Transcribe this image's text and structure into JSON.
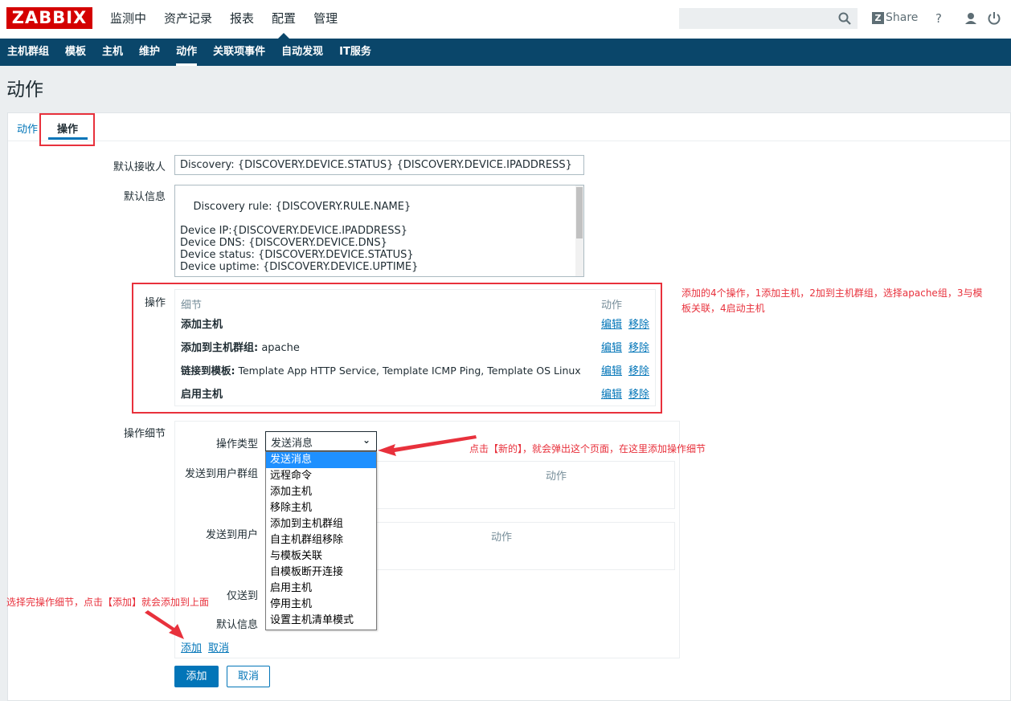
{
  "header": {
    "logo": "ZABBIX",
    "menu": [
      {
        "label": "监测中",
        "active": false
      },
      {
        "label": "资产记录",
        "active": false
      },
      {
        "label": "报表",
        "active": false
      },
      {
        "label": "配置",
        "active": true
      },
      {
        "label": "管理",
        "active": false
      }
    ],
    "search_value": "",
    "share_badge": "Z",
    "share_label": "Share",
    "help_glyph": "?",
    "icons": [
      "search-icon",
      "share-icon",
      "help-icon",
      "user-icon",
      "power-icon"
    ]
  },
  "submenu": [
    {
      "label": "主机群组",
      "active": false
    },
    {
      "label": "模板",
      "active": false
    },
    {
      "label": "主机",
      "active": false
    },
    {
      "label": "维护",
      "active": false
    },
    {
      "label": "动作",
      "active": true
    },
    {
      "label": "关联项事件",
      "active": false
    },
    {
      "label": "自动发现",
      "active": false
    },
    {
      "label": "IT服务",
      "active": false
    }
  ],
  "page": {
    "title": "动作",
    "tabs": [
      {
        "label": "动作",
        "active": false
      },
      {
        "label": "操作",
        "active": true
      }
    ]
  },
  "form": {
    "default_recipient_label": "默认接收人",
    "default_recipient_value": "Discovery: {DISCOVERY.DEVICE.STATUS} {DISCOVERY.DEVICE.IPADDRESS}",
    "default_message_label": "默认信息",
    "default_message_value": "Discovery rule: {DISCOVERY.RULE.NAME}\n\nDevice IP:{DISCOVERY.DEVICE.IPADDRESS}\nDevice DNS: {DISCOVERY.DEVICE.DNS}\nDevice status: {DISCOVERY.DEVICE.STATUS}\nDevice uptime: {DISCOVERY.DEVICE.UPTIME}\n\nDevice service name: {DISCOVERY.SERVICE.NAME}",
    "operations_label": "操作",
    "operations": {
      "col_details": "细节",
      "col_action": "动作",
      "edit_label": "编辑",
      "remove_label": "移除",
      "rows": [
        {
          "bold": "添加主机",
          "rest": ""
        },
        {
          "bold": "添加到主机群组:",
          "rest": " apache"
        },
        {
          "bold": "链接到模板:",
          "rest": " Template App HTTP Service, Template ICMP Ping, Template OS Linux"
        },
        {
          "bold": "启用主机",
          "rest": ""
        }
      ]
    },
    "details_label": "操作细节",
    "details": {
      "op_type_label": "操作类型",
      "op_type_value": "发送消息",
      "send_groups_label": "发送到用户群组",
      "send_users_label": "发送到用户",
      "grid_action_header": "动作",
      "only_send_label": "仅送到",
      "default_msg_label": "默认信息",
      "add_link": "添加",
      "cancel_link": "取消",
      "dropdown_options": [
        "发送消息",
        "远程命令",
        "添加主机",
        "移除主机",
        "添加到主机群组",
        "自主机群组移除",
        "与模板关联",
        "自模板断开连接",
        "启用主机",
        "停用主机",
        "设置主机清单模式"
      ],
      "dropdown_selected_index": 0
    },
    "add_button": "添加",
    "cancel_button": "取消"
  },
  "annotations": {
    "ops_note_line1": "添加的4个操作，1添加主机，2加到主机群组，选择apache组，3与模",
    "ops_note_line2": "板关联，4启动主机",
    "dropdown_note": "点击【新的】，就会弹出这个页面，在这里添加操作细节",
    "add_note": "选择完操作细节，点击【添加】就会添加到上面",
    "accent_color": "#e8313c"
  },
  "colors": {
    "brand_red": "#d40000",
    "nav_dark": "#0a466a",
    "link_blue": "#0275b8"
  }
}
